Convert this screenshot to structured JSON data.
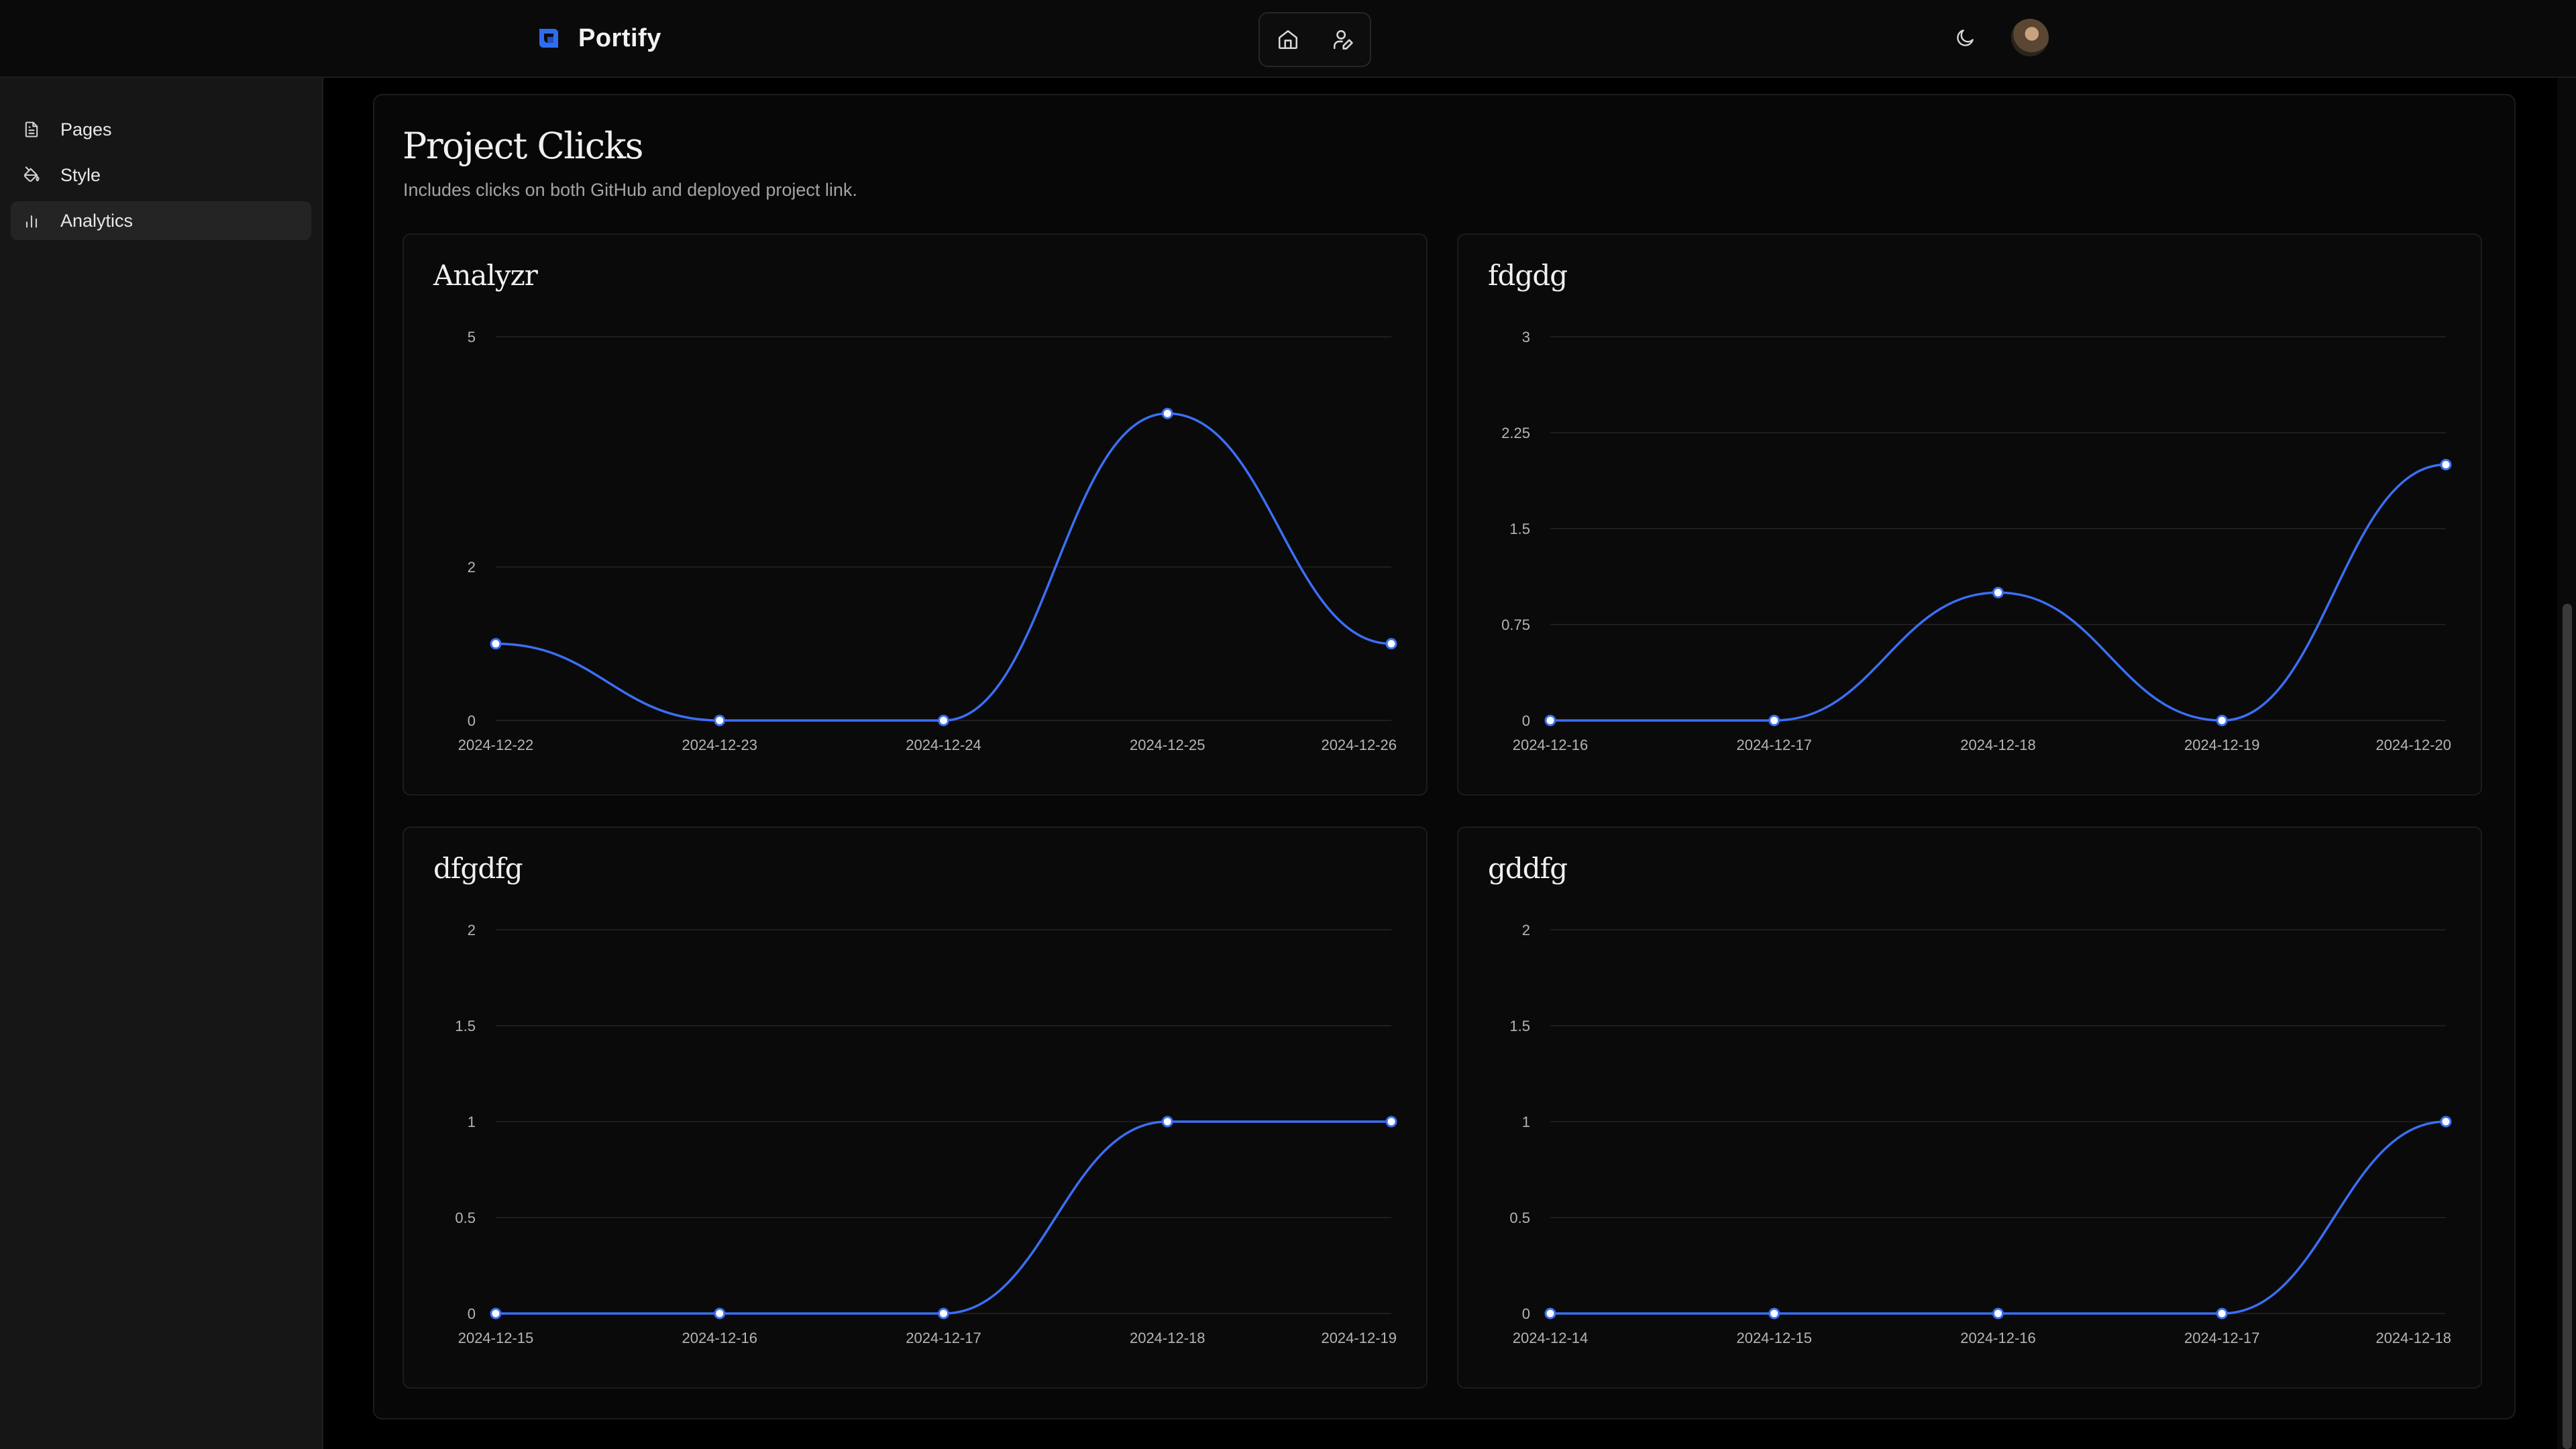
{
  "header": {
    "app_name": "Portify",
    "icons": [
      "brand-logo",
      "home-icon",
      "user-edit-icon",
      "moon-icon",
      "avatar"
    ]
  },
  "sidebar": {
    "items": [
      {
        "label": "Pages",
        "icon": "file-text-icon"
      },
      {
        "label": "Style",
        "icon": "paint-bucket-icon"
      },
      {
        "label": "Analytics",
        "icon": "bar-chart-icon",
        "active": true
      }
    ]
  },
  "main": {
    "title": "Project Clicks",
    "subtitle": "Includes clicks on both GitHub and deployed project link."
  },
  "colors": {
    "accent": "#3b6ff5",
    "background": "#000000",
    "card": "#0a0a0b"
  },
  "chart_data": [
    {
      "type": "line",
      "title": "Analyzr",
      "categories": [
        "2024-12-22",
        "2024-12-23",
        "2024-12-24",
        "2024-12-25",
        "2024-12-26"
      ],
      "values": [
        1,
        0,
        0,
        4,
        1
      ],
      "yticks": [
        "0",
        "2",
        "5"
      ],
      "ylim": [
        0,
        5
      ],
      "grid": true
    },
    {
      "type": "line",
      "title": "fdgdg",
      "categories": [
        "2024-12-16",
        "2024-12-17",
        "2024-12-18",
        "2024-12-19",
        "2024-12-20"
      ],
      "values": [
        0,
        0,
        1,
        0,
        2
      ],
      "yticks": [
        "0",
        "0.75",
        "1.5",
        "2.25",
        "3"
      ],
      "ylim": [
        0,
        3
      ],
      "grid": true
    },
    {
      "type": "line",
      "title": "dfgdfg",
      "categories": [
        "2024-12-15",
        "2024-12-16",
        "2024-12-17",
        "2024-12-18",
        "2024-12-19"
      ],
      "values": [
        0,
        0,
        0,
        1,
        1
      ],
      "yticks": [
        "0",
        "0.5",
        "1",
        "1.5",
        "2"
      ],
      "ylim": [
        0,
        2
      ],
      "grid": true
    },
    {
      "type": "line",
      "title": "gddfg",
      "categories": [
        "2024-12-14",
        "2024-12-15",
        "2024-12-16",
        "2024-12-17",
        "2024-12-18"
      ],
      "values": [
        0,
        0,
        0,
        0,
        1
      ],
      "yticks": [
        "0",
        "0.5",
        "1",
        "1.5",
        "2"
      ],
      "ylim": [
        0,
        2
      ],
      "grid": true
    }
  ]
}
